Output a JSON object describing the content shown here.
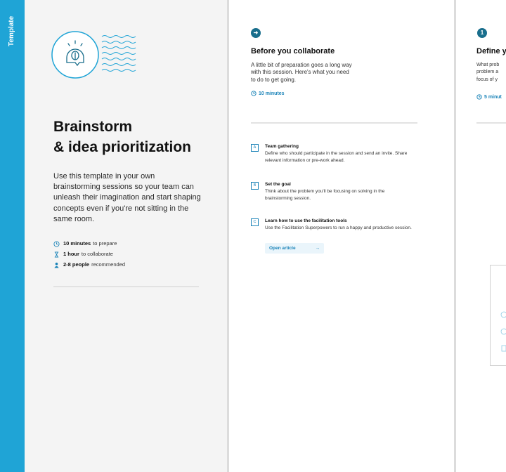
{
  "sidebar_tag": {
    "label": "Template"
  },
  "cover": {
    "title_line1": "Brainstorm",
    "title_line2": "& idea prioritization",
    "description": "Use this template in your own brainstorming sessions so your team can unleash their imagination and start shaping concepts even if you're not sitting in the same room.",
    "meta": [
      {
        "icon": "clock-icon",
        "bold": "10 minutes",
        "text": "to prepare"
      },
      {
        "icon": "hourglass-icon",
        "bold": "1 hour",
        "text": "to collaborate"
      },
      {
        "icon": "person-icon",
        "bold": "2-8 people",
        "text": "recommended"
      }
    ]
  },
  "before": {
    "icon": "arrow-right-icon",
    "title": "Before you collaborate",
    "description": "A little bit of preparation goes a long way\nwith this session. Here's what you need\nto do to get going.",
    "duration": "10 minutes",
    "steps": [
      {
        "letter": "A",
        "title": "Team gathering",
        "text": "Define who should participate in the session and send an invite. Share relevant information or pre-work ahead."
      },
      {
        "letter": "B",
        "title": "Set the goal",
        "text": "Think about the problem you'll be focusing on solving in the brainstorming session."
      },
      {
        "letter": "C",
        "title": "Learn how to use the facilitation tools",
        "text": "Use the Facilitation Superpowers to run a happy and productive session."
      }
    ],
    "open_article": "Open article"
  },
  "step1": {
    "number": "1",
    "title": "Define y",
    "description": "What prob\nproblem a\nfocus of y",
    "duration": "5 minut"
  },
  "colors": {
    "accent": "#1fa4d6",
    "dark_accent": "#196e8c",
    "link": "#1a83b8"
  }
}
